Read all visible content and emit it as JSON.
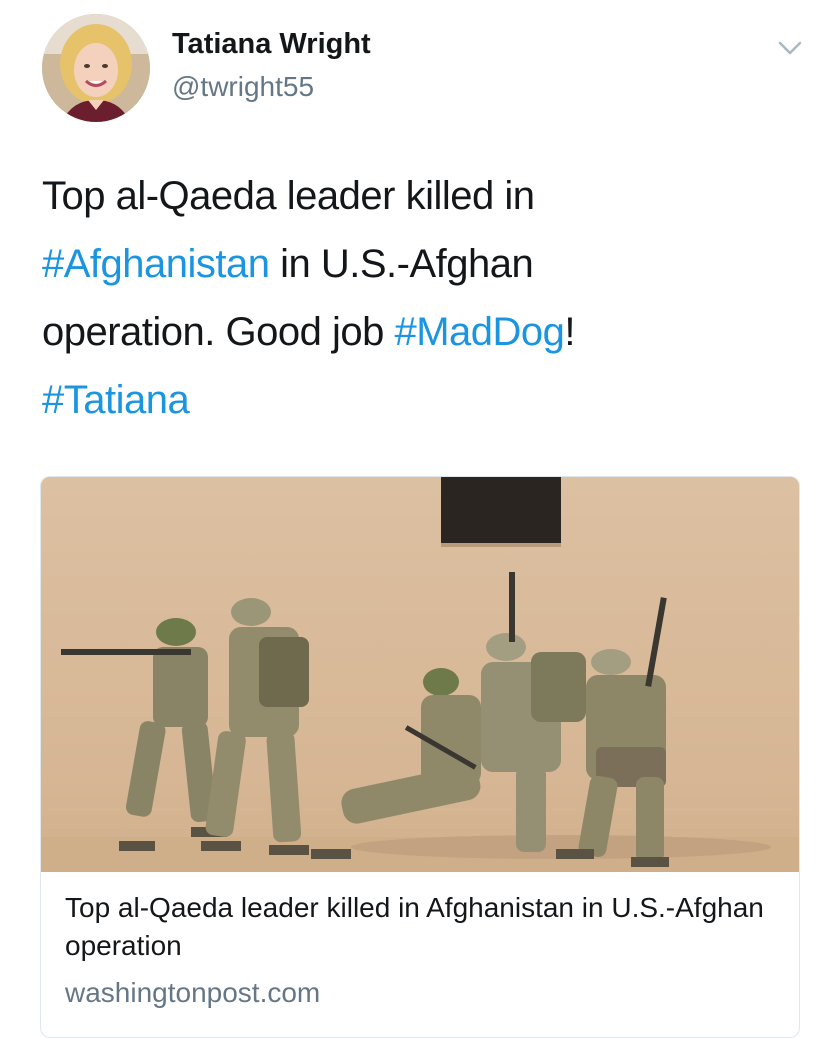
{
  "author": {
    "name": "Tatiana Wright",
    "handle": "@twright55",
    "avatar_icon": "profile-photo"
  },
  "menu": {
    "icon": "chevron-down-icon",
    "color": "#aab8c2"
  },
  "tweet": {
    "lines": [
      [
        {
          "text": "Top al-Qaeda leader killed in",
          "type": "text"
        }
      ],
      [
        {
          "text": "#Afghanistan",
          "type": "hashtag"
        },
        {
          "text": " in U.S.-Afghan",
          "type": "text"
        }
      ],
      [
        {
          "text": "operation. Good job ",
          "type": "text"
        },
        {
          "text": "#MadDog",
          "type": "hashtag"
        },
        {
          "text": "!",
          "type": "text"
        }
      ],
      [
        {
          "text": "#Tatiana",
          "type": "hashtag"
        }
      ]
    ]
  },
  "card": {
    "image_icon": "soldiers-photo",
    "title": "Top al-Qaeda leader killed in Afghanistan in U.S.-Afghan operation",
    "domain": "washingtonpost.com"
  },
  "colors": {
    "text": "#14171a",
    "secondary": "#657786",
    "link": "#1b95e0",
    "border": "#e1e8ed"
  }
}
